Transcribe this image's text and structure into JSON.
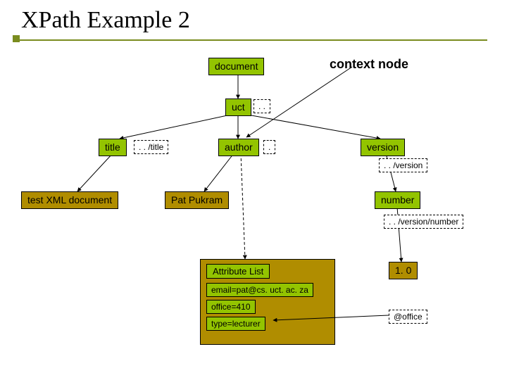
{
  "slide": {
    "title": "XPath Example 2",
    "context_label": "context node"
  },
  "nodes": {
    "document": "document",
    "uct": "uct",
    "title": "title",
    "author": "author",
    "version": "version",
    "test_xml": "test XML document",
    "pat": "Pat Pukram",
    "number": "number",
    "attr_list": "Attribute List",
    "email": "email=pat@cs. uct. ac. za",
    "office": "office=410",
    "type": "type=lecturer",
    "one_zero": "1. 0"
  },
  "xpaths": {
    "dotdot": ". .",
    "dot": ".",
    "title": ". . /title",
    "version": ". . /version",
    "version_number": ". . /version/number",
    "office_attr": "@office"
  },
  "diagram": {
    "description": "XML document tree with XPath expressions. Root 'document' → 'uct' → children title, author, version. title → 'test XML document'. author → 'Pat Pukram' and Attribute List (email, office, type). version → number → '1. 0'. Context node is 'author'; dashed boxes show relative XPath expressions from that context."
  }
}
